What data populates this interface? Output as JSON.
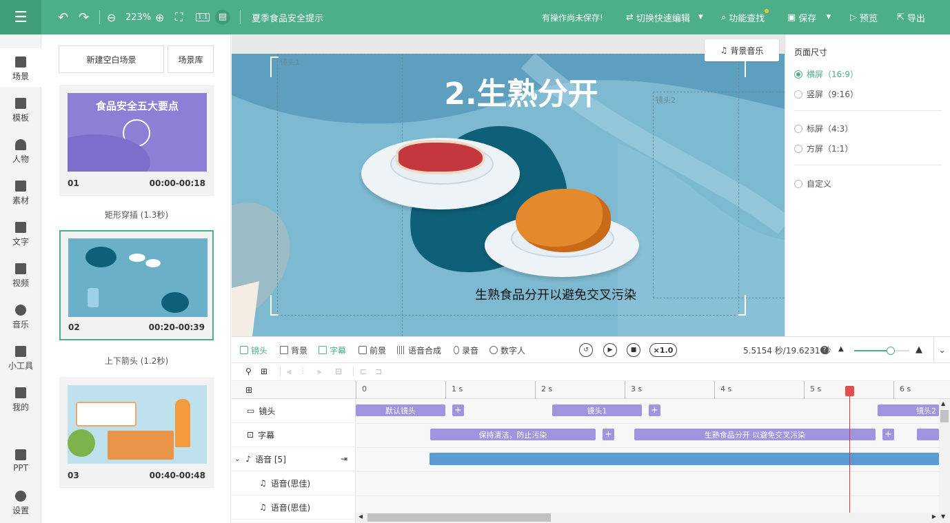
{
  "topbar": {
    "undo_icon": "undo-icon",
    "redo_icon": "redo-icon",
    "zoom": "223%",
    "doc_title": "夏季食品安全提示",
    "unsaved_notice": "有操作尚未保存!",
    "quick_edit": "切换快速编辑",
    "feature_search": "功能查找",
    "save": "保存",
    "preview": "预览",
    "export": "导出"
  },
  "nav": [
    {
      "label": "场景",
      "icon": "scene-icon"
    },
    {
      "label": "模板",
      "icon": "template-icon"
    },
    {
      "label": "人物",
      "icon": "person-icon"
    },
    {
      "label": "素材",
      "icon": "material-icon"
    },
    {
      "label": "文字",
      "icon": "text-icon"
    },
    {
      "label": "视频",
      "icon": "video-icon"
    },
    {
      "label": "音乐",
      "icon": "music-icon"
    },
    {
      "label": "小工具",
      "icon": "toolbox-icon"
    },
    {
      "label": "我的",
      "icon": "upload-icon"
    },
    {
      "label": "PPT",
      "icon": "ppt-icon"
    },
    {
      "label": "设置",
      "icon": "gear-icon"
    }
  ],
  "scenes_panel": {
    "new_blank": "新建空白场景",
    "library": "场景库",
    "cards": [
      {
        "num": "01",
        "time": "00:00-00:18",
        "thumb_title": "食品安全五大要点"
      },
      {
        "num": "02",
        "time": "00:20-00:39"
      },
      {
        "num": "03",
        "time": "00:40-00:48"
      }
    ],
    "transitions": [
      "矩形穿插 (1.3秒)",
      "上下箭头 (1.2秒)"
    ]
  },
  "canvas": {
    "bg_music": "背景音乐",
    "lens1": "镜头1",
    "lens2": "镜头2",
    "heading": "2.生熟分开",
    "caption": "生熟食品分开以避免交叉污染"
  },
  "right_panel": {
    "title": "页面尺寸",
    "options": [
      {
        "label": "横屏（16:9）",
        "selected": true
      },
      {
        "label": "竖屏（9:16）",
        "selected": false
      },
      {
        "label": "标屏（4:3）",
        "selected": false
      },
      {
        "label": "方屏（1:1）",
        "selected": false
      },
      {
        "label": "自定义",
        "selected": false
      }
    ]
  },
  "timeline": {
    "tabs": [
      "镜头",
      "背景",
      "字幕",
      "前景",
      "语音合成",
      "录音",
      "数字人"
    ],
    "speed": "×1.0",
    "time_readout": "5.5154 秒/19.6231 秒",
    "ruler": [
      "0",
      "1 s",
      "2 s",
      "3 s",
      "4 s",
      "5 s",
      "6 s"
    ],
    "tracks": [
      "镜头",
      "字幕",
      "语音 [5]",
      "语音(思佳)",
      "语音(思佳)"
    ],
    "lens_clips": [
      "默认镜头",
      "镜头1",
      "镜头2"
    ],
    "subtitle_clips": [
      "保持清洁，防止污染",
      "生熟食品分开 以避免交叉污染"
    ],
    "playhead_seconds": 5.5154,
    "duration_seconds": 19.6231
  },
  "colors": {
    "brand": "#4caf88",
    "clip": "#9f94e0",
    "voice": "#5b9bd5"
  }
}
